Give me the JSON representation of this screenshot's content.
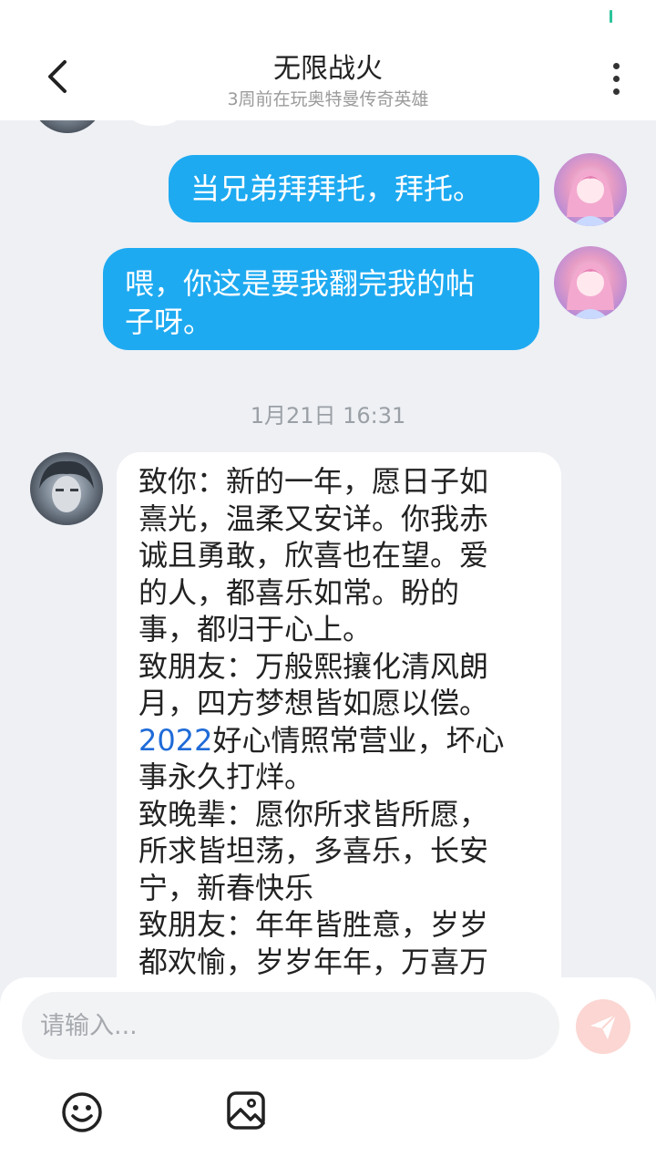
{
  "header": {
    "title": "无限战火",
    "subtitle": "3周前在玩奥特曼传奇英雄"
  },
  "messages": {
    "m1": "当兄弟拜拜托，拜托。",
    "m2_line1": "喂，你这是要我翻完我的帖",
    "m2_line2": "子呀。",
    "timestamp": "1月21日 16:31",
    "m3": {
      "l1": "致你：新的一年，愿日子如",
      "l2": "熹光，温柔又安详。你我赤",
      "l3": "诚且勇敢，欣喜也在望。爱",
      "l4": "的人，都喜乐如常。盼的",
      "l5": "事，都归于心上。",
      "l6": "致朋友：万般熙攘化清风朗",
      "l7": "月，四方梦想皆如愿以偿。",
      "l8_num": "2022",
      "l8_rest": "好心情照常营业，坏心",
      "l9": "事永久打烊。",
      "l10": "致晚辈：愿你所求皆所愿，",
      "l11": "所求皆坦荡，多喜乐，长安",
      "l12": "宁，新春快乐",
      "l13": "致朋友：年年皆胜意，岁岁",
      "l14": "都欢愉，岁岁年年，万喜万"
    }
  },
  "composer": {
    "placeholder": "请输入..."
  },
  "colors": {
    "my_bubble": "#1eaaf1",
    "number_link": "#1f6bd8",
    "send_button": "#fbd6d2"
  }
}
